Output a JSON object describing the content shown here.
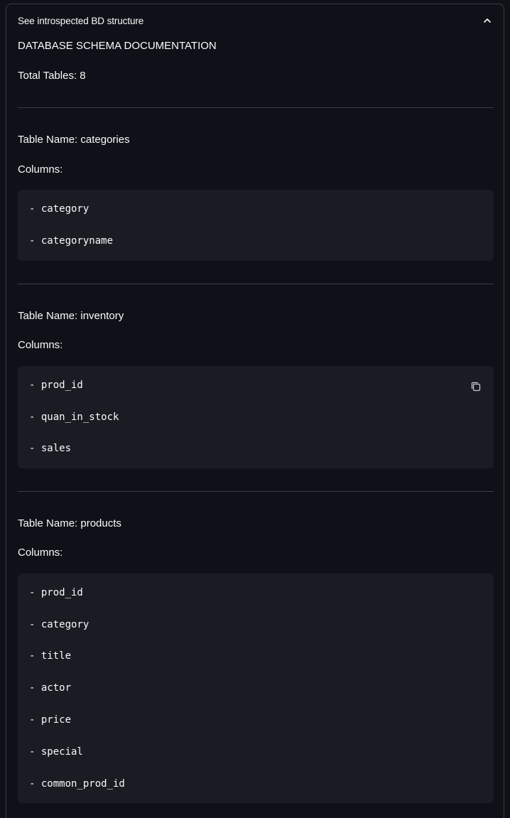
{
  "expander": {
    "title": "See introspected BD structure",
    "expanded": true
  },
  "doc": {
    "heading": "DATABASE SCHEMA DOCUMENTATION",
    "total_tables": "Total Tables: 8"
  },
  "tables": [
    {
      "name_label": "Table Name: categories",
      "columns_label": "Columns:",
      "columns": [
        "- category",
        "- categoryname"
      ]
    },
    {
      "name_label": "Table Name: inventory",
      "columns_label": "Columns:",
      "columns": [
        "- prod_id",
        "- quan_in_stock",
        "- sales"
      ]
    },
    {
      "name_label": "Table Name: products",
      "columns_label": "Columns:",
      "columns": [
        "- prod_id",
        "- category",
        "- title",
        "- actor",
        "- price",
        "- special",
        "- common_prod_id"
      ]
    }
  ],
  "icons": {
    "chevron": "chevron-up-icon",
    "copy": "copy-icon"
  },
  "colors": {
    "background": "#0e1117",
    "code_background": "#1a1c24",
    "text": "#fafafa",
    "divider": "#3d4049"
  }
}
